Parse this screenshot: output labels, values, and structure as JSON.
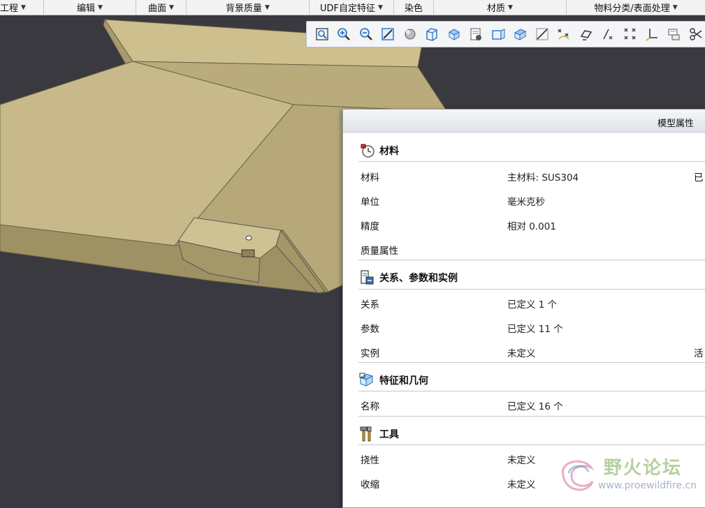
{
  "menubar": {
    "items": [
      {
        "label": "工程",
        "arrow": "▼"
      },
      {
        "label": "编辑",
        "arrow": "▼"
      },
      {
        "label": "曲面",
        "arrow": "▼"
      },
      {
        "label": "背景质量",
        "arrow": "▼"
      },
      {
        "label": "UDF自定特征",
        "arrow": "▼"
      },
      {
        "label": "染色",
        "arrow": ""
      },
      {
        "label": "材质",
        "arrow": "▼"
      },
      {
        "label": "物料分类/表面处理",
        "arrow": "▼"
      }
    ]
  },
  "toolbar": {
    "icons": [
      "zoom-fit-icon",
      "zoom-in-icon",
      "zoom-out-icon",
      "repaint-icon",
      "shading-icon",
      "cube-view-icon",
      "saved-view-icon",
      "layer-icon",
      "spin-center-icon",
      "datum-plane-icon",
      "datum-axis-icon",
      "datum-point-icon",
      "sketch-icon",
      "coordinate-icon",
      "annotation-icon",
      "csys-icon",
      "feature-list-icon",
      "trim-icon"
    ]
  },
  "dialog": {
    "title": "模型属性",
    "sections": [
      {
        "heading": "材料",
        "icon": "material-icon",
        "rows": [
          {
            "label": "材料",
            "value": "主材料: SUS304",
            "extra": "已"
          },
          {
            "label": "单位",
            "value": "毫米克秒",
            "extra": ""
          },
          {
            "label": "精度",
            "value": "相对 0.001",
            "extra": ""
          },
          {
            "label": "质量属性",
            "value": "",
            "extra": ""
          }
        ]
      },
      {
        "heading": "关系、参数和实例",
        "icon": "relations-icon",
        "rows": [
          {
            "label": "关系",
            "value": "已定义 1 个",
            "extra": ""
          },
          {
            "label": "参数",
            "value": "已定义 11 个",
            "extra": ""
          },
          {
            "label": "实例",
            "value": "未定义",
            "extra": "活"
          }
        ]
      },
      {
        "heading": "特征和几何",
        "icon": "feature-geometry-icon",
        "rows": [
          {
            "label": "名称",
            "value": "已定义 16 个",
            "extra": ""
          }
        ]
      },
      {
        "heading": "工具",
        "icon": "tools-icon",
        "rows": [
          {
            "label": "挠性",
            "value": "未定义",
            "extra": ""
          },
          {
            "label": "收缩",
            "value": "未定义",
            "extra": ""
          }
        ]
      }
    ]
  },
  "watermark": {
    "text": "野火论坛",
    "url": "www.proewildfire.cn"
  },
  "colors": {
    "viewport_bg": "#3a393f",
    "sheet_metal": "#c8bb8a",
    "dialog_bg": "#ffffff"
  }
}
